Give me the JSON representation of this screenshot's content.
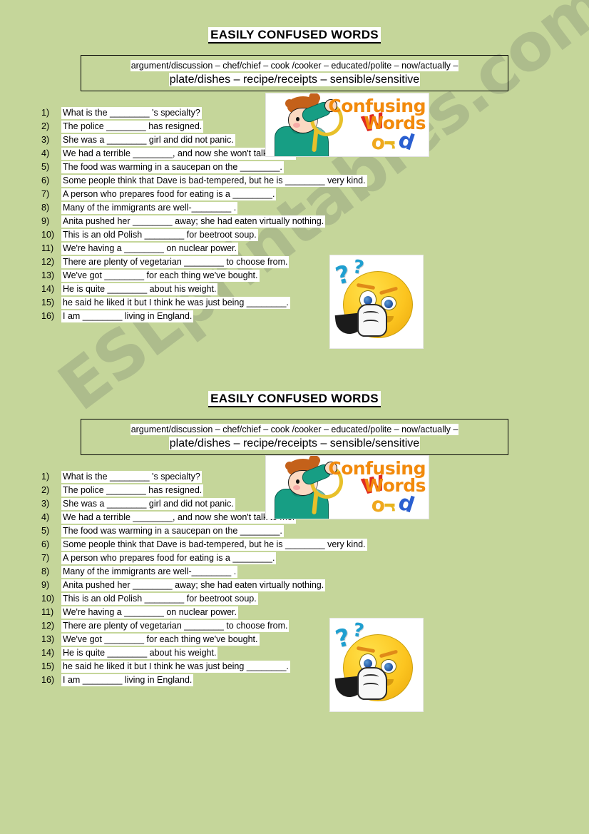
{
  "page": {
    "background_color": "#c5d69a",
    "watermark_text": "ESLprintables.com"
  },
  "worksheet": {
    "title": "EASILY CONFUSED WORDS",
    "wordbank": {
      "line1": "argument/discussion – chef/chief – cook /cooker – educated/polite – now/actually –",
      "line2": "plate/dishes – recipe/receipts – sensible/sensitive"
    },
    "questions": [
      {
        "num": "1)",
        "text": "What is the ________ 's specialty?"
      },
      {
        "num": "2)",
        "text": "The police ________ has resigned."
      },
      {
        "num": "3)",
        "text": "She was a ________ girl and did not panic."
      },
      {
        "num": "4)",
        "text": "We had a terrible ________, and now she won't talk to me."
      },
      {
        "num": "5)",
        "text": "The food was warming in a saucepan on the ________."
      },
      {
        "num": "6)",
        "text": "Some people think that Dave is bad-tempered, but he is ________ very kind."
      },
      {
        "num": "7)",
        "text": "A person who prepares food for eating is a ________."
      },
      {
        "num": "8)",
        "text": "Many of the immigrants are well-________ ."
      },
      {
        "num": "9)",
        "text": "Anita pushed her ________ away; she had eaten virtually nothing."
      },
      {
        "num": "10)",
        "text": "This is an old Polish ________ for beetroot soup."
      },
      {
        "num": "11)",
        "text": "We're having a ________ on nuclear power."
      },
      {
        "num": "12)",
        "text": "There are plenty of vegetarian ________ to choose from."
      },
      {
        "num": "13)",
        "text": "We've got ________ for each thing we've bought."
      },
      {
        "num": "14)",
        "text": "He is quite ________ about his weight."
      },
      {
        "num": "15)",
        "text": "he said he liked it but I think he was just being ________."
      },
      {
        "num": "16)",
        "text": "I am ________ living in England."
      }
    ],
    "clipart": {
      "banner_line1": "Confusing",
      "banner_line2": "Words",
      "banner_letter_w": "W",
      "banner_letter_o": "o",
      "banner_letter_r": "r",
      "banner_letter_d": "d",
      "emoji_question_big": "?",
      "emoji_question_small": "?"
    }
  }
}
